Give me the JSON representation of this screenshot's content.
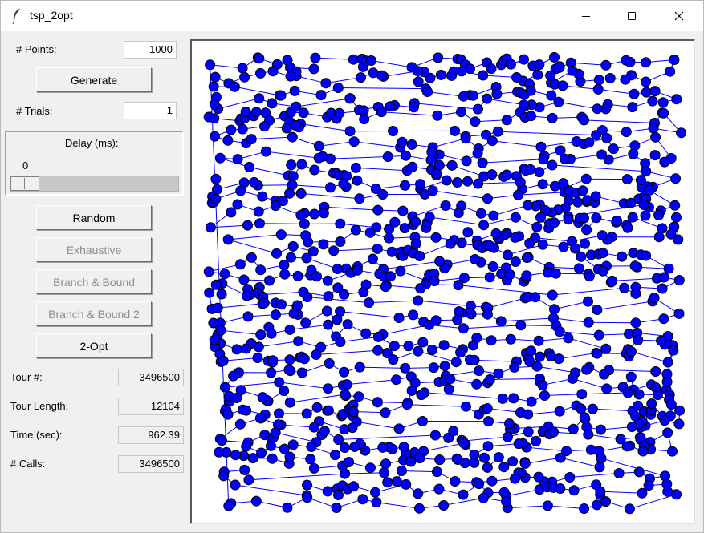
{
  "window": {
    "title": "tsp_2opt",
    "controls": [
      "minimize-icon",
      "maximize-icon",
      "close-icon"
    ]
  },
  "inputs": {
    "points_label": "# Points:",
    "points_value": "1000",
    "generate_label": "Generate",
    "trials_label": "# Trials:",
    "trials_value": "1"
  },
  "delay": {
    "label": "Delay (ms):",
    "value": "0",
    "slider_level": 0
  },
  "buttons": {
    "random": "Random",
    "exhaustive": "Exhaustive",
    "branch_bound": "Branch & Bound",
    "branch_bound_2": "Branch & Bound 2",
    "two_opt": "2-Opt"
  },
  "stats": {
    "tour_num_label": "Tour #:",
    "tour_num_value": "3496500",
    "tour_length_label": "Tour Length:",
    "tour_length_value": "12104",
    "time_label": "Time (sec):",
    "time_value": "962.39",
    "calls_label": "# Calls:",
    "calls_value": "3496500"
  },
  "canvas": {
    "point_count": 1000,
    "point_fill": "#0000ff",
    "point_outline": "#000000",
    "edge_color": "#0000ff",
    "background": "#ffffff"
  }
}
